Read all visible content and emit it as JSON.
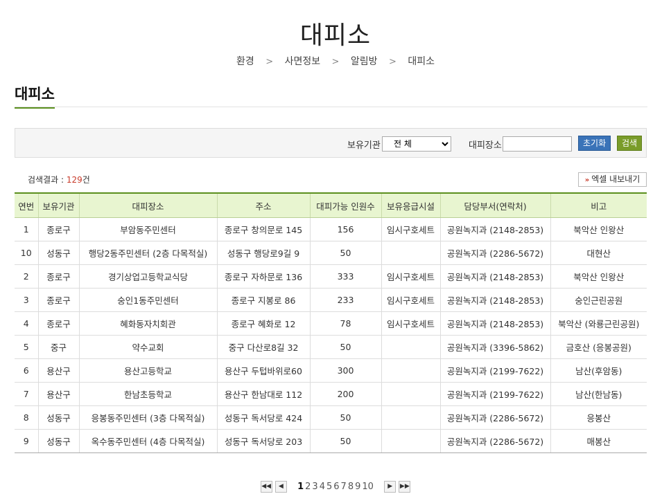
{
  "page": {
    "title": "대피소"
  },
  "breadcrumb": [
    "환경",
    "사면정보",
    "알림방",
    "대피소"
  ],
  "section": {
    "title": "대피소"
  },
  "search": {
    "org_label": "보유기관",
    "org_selected": "전 체",
    "place_label": "대피장소",
    "place_value": "",
    "reset_label": "초기화",
    "search_label": "검색"
  },
  "result": {
    "prefix": "검색결과 : ",
    "count": "129",
    "suffix": "건"
  },
  "excel": {
    "label": "엑셀 내보내기"
  },
  "table": {
    "headers": [
      "연번",
      "보유기관",
      "대피장소",
      "주소",
      "대피가능 인원수",
      "보유응급시설",
      "담당부서(연락처)",
      "비고"
    ],
    "rows": [
      [
        "1",
        "종로구",
        "부암동주민센터",
        "종로구 창의문로 145",
        "156",
        "임시구호세트",
        "공원녹지과 (2148-2853)",
        "북악산 인왕산"
      ],
      [
        "10",
        "성동구",
        "행당2동주민센터 (2층 다목적실)",
        "성동구 행당로9길 9",
        "50",
        "",
        "공원녹지과 (2286-5672)",
        "대현산"
      ],
      [
        "2",
        "종로구",
        "경기상업고등학교식당",
        "종로구 자하문로 136",
        "333",
        "임시구호세트",
        "공원녹지과 (2148-2853)",
        "북악산 인왕산"
      ],
      [
        "3",
        "종로구",
        "숭인1동주민센터",
        "종로구 지봉로 86",
        "233",
        "임시구호세트",
        "공원녹지과 (2148-2853)",
        "숭인근린공원"
      ],
      [
        "4",
        "종로구",
        "혜화동자치회관",
        "종로구 혜화로 12",
        "78",
        "임시구호세트",
        "공원녹지과 (2148-2853)",
        "북악산 (와룡근린공원)"
      ],
      [
        "5",
        "중구",
        "약수교회",
        "중구 다산로8길 32",
        "50",
        "",
        "공원녹지과 (3396-5862)",
        "금호산 (응봉공원)"
      ],
      [
        "6",
        "용산구",
        "용산고등학교",
        "용산구 두텁바위로60",
        "300",
        "",
        "공원녹지과 (2199-7622)",
        "남산(후암동)"
      ],
      [
        "7",
        "용산구",
        "한남초등학교",
        "용산구 한남대로 112",
        "200",
        "",
        "공원녹지과 (2199-7622)",
        "남산(한남동)"
      ],
      [
        "8",
        "성동구",
        "응봉동주민센터 (3층 다목적실)",
        "성동구 독서당로 424",
        "50",
        "",
        "공원녹지과 (2286-5672)",
        "응봉산"
      ],
      [
        "9",
        "성동구",
        "옥수동주민센터 (4층 다목적실)",
        "성동구 독서당로 203",
        "50",
        "",
        "공원녹지과 (2286-5672)",
        "매봉산"
      ]
    ]
  },
  "pagination": {
    "first": "◀◀",
    "prev": "◀",
    "next": "▶",
    "last": "▶▶",
    "pages": [
      "1",
      "2",
      "3",
      "4",
      "5",
      "6",
      "7",
      "8",
      "9",
      "10"
    ],
    "current": "1"
  },
  "colors": {
    "accent_green": "#5a8f1d",
    "header_bg": "#e8f5d0",
    "count_red": "#c83a2a",
    "reset_blue": "#3a73b8",
    "search_olive": "#7a9c2a"
  }
}
